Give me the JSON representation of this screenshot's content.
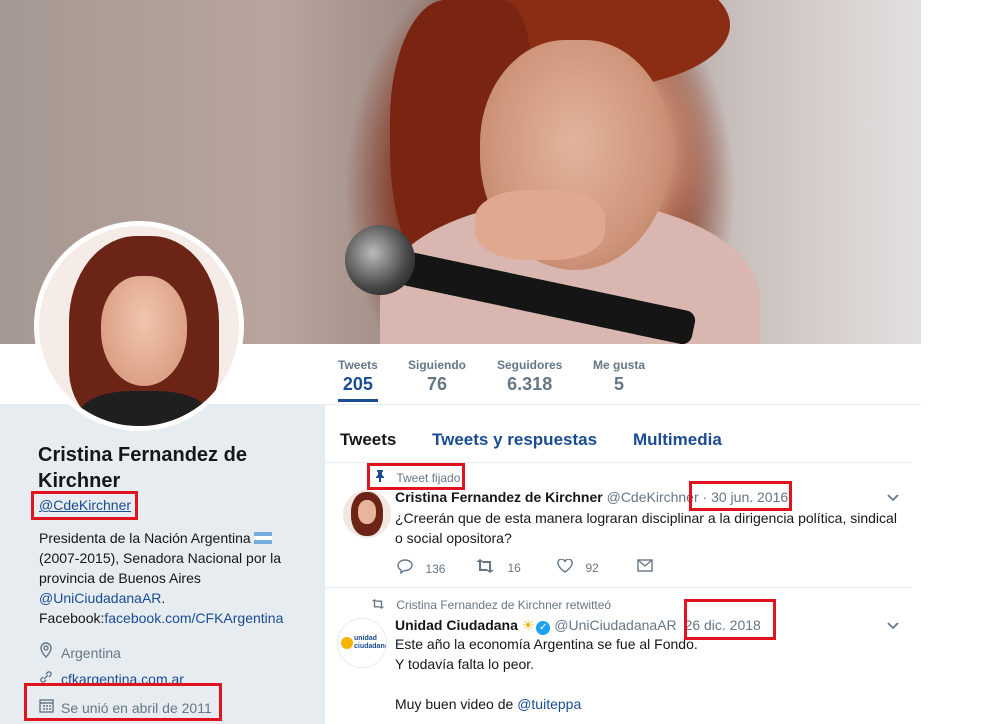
{
  "banner": {
    "description_icon": "profile-banner-photo"
  },
  "stats": [
    {
      "label": "Tweets",
      "value": "205"
    },
    {
      "label": "Siguiendo",
      "value": "76"
    },
    {
      "label": "Seguidores",
      "value": "6.318"
    },
    {
      "label": "Me gusta",
      "value": "5"
    }
  ],
  "profile": {
    "name": "Cristina Fernandez de Kirchner",
    "handle": "@CdeKirchner",
    "bio_line1": "Presidenta de la Nación Argentina",
    "bio_line2": "(2007-2015), Senadora Nacional por la",
    "bio_line3": "provincia de Buenos Aires",
    "bio_mention": "@UniCiudadanaAR",
    "bio_period": ".",
    "bio_fb_prefix": "Facebook:",
    "bio_fb_link": "facebook.com/CFKArgentina",
    "location": "Argentina",
    "website": "cfkargentina.com.ar",
    "joined": "Se unió en abril de 2011"
  },
  "tabs": [
    {
      "label": "Tweets"
    },
    {
      "label": "Tweets y respuestas"
    },
    {
      "label": "Multimedia"
    }
  ],
  "tweets": [
    {
      "context": "Tweet fijado",
      "name": "Cristina Fernandez de Kirchner",
      "screen_name": "@CdeKirchner",
      "sep": "·",
      "date": "30 jun. 2016",
      "text": "¿Creerán que de esta manera lograran disciplinar a la dirigencia política, sindical o social opositora?",
      "replies": "136",
      "retweets": "16",
      "likes": "92"
    },
    {
      "context": "Cristina Fernandez de Kirchner retwitteó",
      "name": "Unidad Ciudadana",
      "name_emoji": "☀",
      "screen_name": "@UniCiudadanaAR",
      "date": "26 dic. 2018",
      "line1": "Este año la economía Argentina se fue al Fondo.",
      "line2": "Y todavía falta lo peor.",
      "line3_prefix": "Muy buen video de ",
      "line3_mention": "@tuiteppa",
      "avatar_text": "unidad ciudadana"
    }
  ],
  "colors": {
    "accent": "#1b4c93",
    "highlight": "#e0141e",
    "muted": "#657786"
  }
}
